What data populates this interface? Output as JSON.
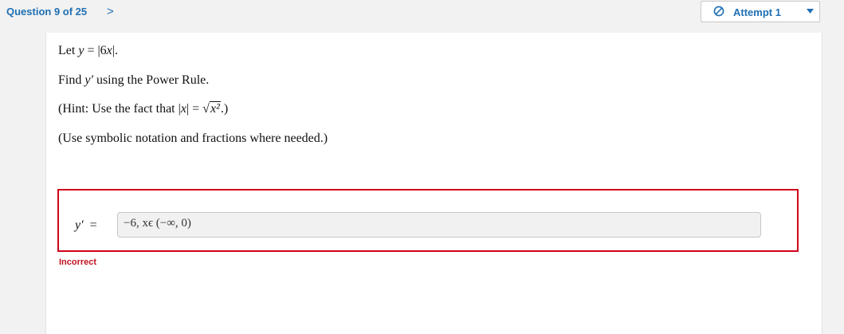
{
  "nav": {
    "question_label": "Question 9 of 25",
    "next_symbol": ">"
  },
  "attempt": {
    "label": "Attempt 1",
    "icon": "no-entry-icon"
  },
  "question": {
    "line1_prefix": "Let ",
    "line1_var": "y",
    "line1_eq": " = |6",
    "line1_x": "x",
    "line1_end": "|.",
    "line2_prefix": "Find ",
    "line2_var": "y′",
    "line2_suffix": " using the Power Rule.",
    "line3_prefix": "(Hint: Use the fact that |",
    "line3_x": "x",
    "line3_mid": "| = ",
    "line3_rad": "x²",
    "line3_end": ".)",
    "line4": "(Use symbolic notation and fractions where needed.)"
  },
  "answer": {
    "var": "y′",
    "eq": "=",
    "value": "−6, xϵ (−∞, 0)"
  },
  "status": "Incorrect",
  "colors": {
    "accent": "#1f6fb3",
    "error": "#d0021b",
    "page_bg": "#f2f2f2"
  }
}
